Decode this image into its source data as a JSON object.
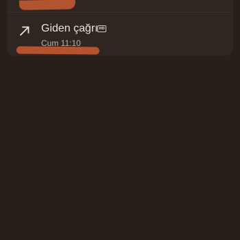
{
  "call_log": {
    "entry": {
      "type_label": "Giden çağrı",
      "quality_badge": "HD",
      "time": "Cum 11:10",
      "direction_icon": "outgoing-arrow-icon"
    }
  },
  "colors": {
    "background": "#281f1a",
    "card": "#2f2621",
    "redaction": "#b4532f",
    "text_primary": "#ece3dc",
    "text_secondary": "#bdb3ab"
  }
}
